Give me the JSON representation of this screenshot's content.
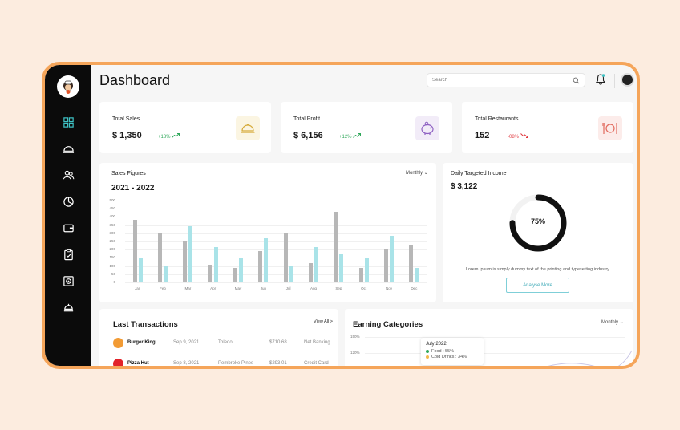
{
  "app": {
    "title": "Dashboard"
  },
  "search": {
    "placeholder": "Search"
  },
  "nav": [
    {
      "name": "dashboard-icon"
    },
    {
      "name": "food-cloche-icon"
    },
    {
      "name": "users-icon"
    },
    {
      "name": "chart-pie-icon"
    },
    {
      "name": "wallet-icon"
    },
    {
      "name": "clipboard-icon"
    },
    {
      "name": "safe-icon"
    },
    {
      "name": "serving-icon"
    }
  ],
  "stats": [
    {
      "label": "Total Sales",
      "value": "$ 1,350",
      "delta": "+18%",
      "trend": "up",
      "icon": "cloche-icon",
      "color": "#d6ab3a"
    },
    {
      "label": "Total Profit",
      "value": "$ 6,156",
      "delta": "+12%",
      "trend": "up",
      "icon": "piggy-bank-icon",
      "color": "#8d5fc2"
    },
    {
      "label": "Total Restaurants",
      "value": "152",
      "delta": "-08%",
      "trend": "down",
      "icon": "restaurant-icon",
      "color": "#e26a5e"
    }
  ],
  "colors": {
    "up": "#2fa85a",
    "down": "#e0383e",
    "bar_gray": "#b7b7b7",
    "bar_teal": "#a9e3e8",
    "accent": "#f5a55a"
  },
  "sales": {
    "title": "Sales Figures",
    "range": "2021 - 2022",
    "period": "Monthly"
  },
  "chart_data": {
    "type": "bar",
    "categories": [
      "Jan",
      "Feb",
      "Mar",
      "Apr",
      "May",
      "Jun",
      "Jul",
      "Aug",
      "Sep",
      "Oct",
      "Nov",
      "Dec"
    ],
    "y_ticks": [
      "500",
      "450",
      "400",
      "350",
      "300",
      "250",
      "200",
      "150",
      "100",
      "50",
      "0"
    ],
    "ylim": [
      0,
      500
    ],
    "series": [
      {
        "values": [
          380,
          300,
          250,
          110,
          90,
          190,
          300,
          120,
          430,
          90,
          200,
          230
        ]
      },
      {
        "values": [
          150,
          100,
          345,
          215,
          150,
          270,
          100,
          215,
          170,
          150,
          285,
          90
        ]
      }
    ]
  },
  "income": {
    "title": "Daily Targeted Income",
    "value": "$ 3,122",
    "percent": "75%",
    "progress": 0.75,
    "description": "Lorem Ipsum is simply dummy text of the printing and typesetting industry.",
    "button": "Analyse More"
  },
  "transactions": {
    "title": "Last Transactions",
    "view_all": "View All",
    "rows": [
      {
        "name": "Burger King",
        "date": "Sep 9, 2021",
        "city": "Toledo",
        "amount": "$710.68",
        "method": "Net Banking",
        "logo_color": "#f29b35"
      },
      {
        "name": "Pizza Hut",
        "date": "Sep 8, 2021",
        "city": "Pembroke Pines",
        "amount": "$293.01",
        "method": "Credit Card",
        "logo_color": "#e2232a"
      }
    ]
  },
  "earning": {
    "title": "Earning Categories",
    "period": "Monthly",
    "y_ticks": [
      "150%",
      "120%"
    ],
    "tooltip": {
      "title": "July 2022",
      "rows": [
        {
          "label": "Food : 55%",
          "color": "#2fa85a"
        },
        {
          "label": "Cold Drinks : 34%",
          "color": "#f2b84b"
        }
      ]
    }
  }
}
